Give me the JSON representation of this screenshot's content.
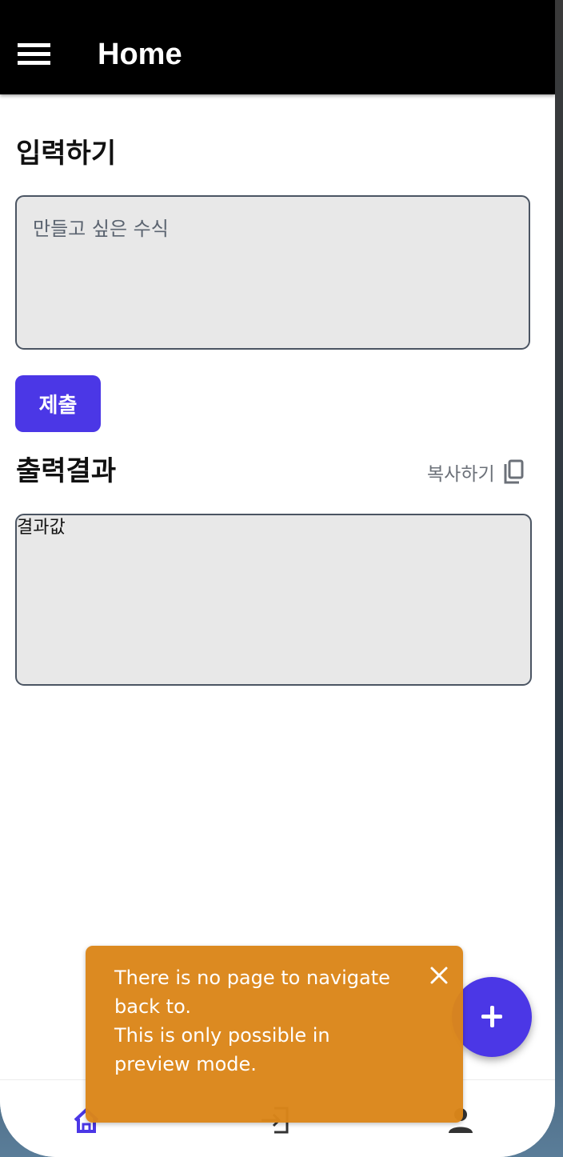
{
  "app_bar": {
    "title": "Home",
    "menu_icon": "hamburger-menu-icon"
  },
  "input_section": {
    "title": "입력하기",
    "placeholder": "만들고 싶은 수식",
    "value": ""
  },
  "submit_button": {
    "label": "제출"
  },
  "output_section": {
    "title": "출력결과",
    "copy_label": "복사하기",
    "copy_icon": "copy-icon",
    "result_text": "결과값"
  },
  "fab": {
    "icon": "plus-icon",
    "color": "#4b37e6"
  },
  "toast": {
    "line1": "There is no page to navigate back to.",
    "line2": "This is only possible in preview mode.",
    "close_icon": "close-icon",
    "color": "#db861a"
  },
  "bottom_nav": {
    "items": [
      {
        "icon": "home-icon",
        "active": true
      },
      {
        "icon": "login-icon",
        "active": false
      },
      {
        "icon": "person-icon",
        "active": false
      }
    ],
    "active_color": "#4b37e6"
  },
  "colors": {
    "accent": "#4b37e6",
    "app_bar": "#000000",
    "field_bg": "#e8e8e8"
  }
}
